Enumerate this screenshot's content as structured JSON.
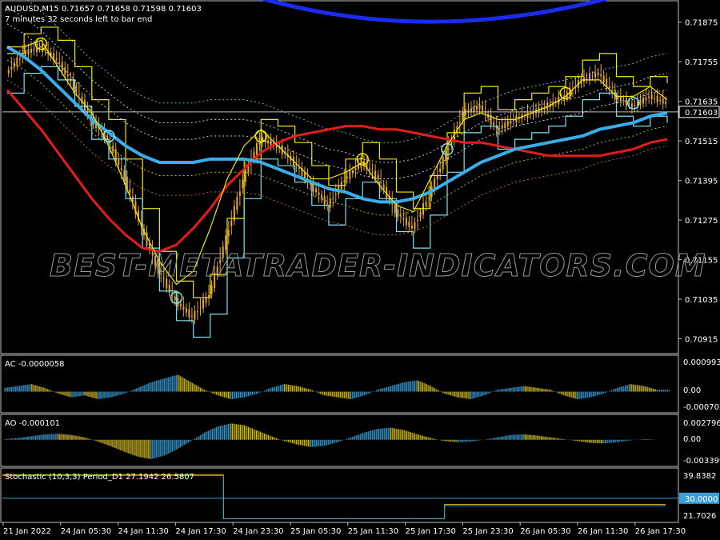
{
  "header": {
    "symbol_line": "AUDUSD,M15  0.71657 0.71658 0.71598 0.71603",
    "timer_line": "7 minutes 32 seconds left to bar end"
  },
  "watermark": "BEST-METATRADER-INDICATORS.COM",
  "colors": {
    "background": "#000000",
    "candle": "#e0a63a",
    "channel_yellow": "#f2e600",
    "channel_cyan": "#7fe0f0",
    "ma_blue_thick": "#3aaeea",
    "ma_red": "#e51c1c",
    "ma_navy": "#1a2cf0",
    "hist_yellow": "#d8c020",
    "hist_blue": "#3a9fd8",
    "stoch_main": "#d8c020",
    "stoch_signal": "#3a9fd8",
    "level_line": "#3a9fd8"
  },
  "chart_data": [
    {
      "type": "line",
      "panel": "price",
      "title": "AUDUSD,M15",
      "ohlc_last": {
        "open": 0.71657,
        "high": 0.71658,
        "low": 0.71598,
        "close": 0.71603
      },
      "current_price_label": "0.71603",
      "y_ticks": [
        "0.71875",
        "0.71755",
        "0.71635",
        "0.71515",
        "0.71395",
        "0.71275",
        "0.71155",
        "0.71035",
        "0.70915"
      ],
      "ylim": [
        0.70875,
        0.71935
      ],
      "x_ticks": [
        "21 Jan 2022",
        "24 Jan 05:30",
        "24 Jan 11:30",
        "24 Jan 17:30",
        "24 Jan 23:30",
        "25 Jan 05:30",
        "25 Jan 11:30",
        "25 Jan 17:30",
        "25 Jan 23:30",
        "26 Jan 05:30",
        "26 Jan 11:30",
        "26 Jan 17:30"
      ],
      "series": [
        {
          "values": [
            0.7172,
            0.7178,
            0.718,
            0.7176,
            0.7168,
            0.7158,
            0.7152,
            0.714,
            0.7125,
            0.7112,
            0.7103,
            0.7098,
            0.7105,
            0.7122,
            0.714,
            0.7152,
            0.715,
            0.7145,
            0.7138,
            0.7132,
            0.714,
            0.7145,
            0.714,
            0.713,
            0.7125,
            0.7135,
            0.7148,
            0.716,
            0.7162,
            0.7155,
            0.7158,
            0.716,
            0.7162,
            0.7165,
            0.717,
            0.7172,
            0.7165,
            0.7162,
            0.7165,
            0.7163
          ]
        },
        {
          "values": [
            0.718,
            0.718,
            0.7182,
            0.7174,
            0.7166,
            0.716,
            0.715,
            0.7138,
            0.7125,
            0.7115,
            0.7108,
            0.7112,
            0.7125,
            0.714,
            0.715,
            0.7155,
            0.715,
            0.7145,
            0.714,
            0.714,
            0.7142,
            0.7145,
            0.7138,
            0.7132,
            0.713,
            0.714,
            0.715,
            0.7158,
            0.716,
            0.7158,
            0.7158,
            0.716,
            0.7162,
            0.7165,
            0.717,
            0.717,
            0.7165,
            0.7165,
            0.7168,
            0.7164
          ]
        },
        {
          "values": [
            0.718,
            0.7177,
            0.7173,
            0.7168,
            0.7163,
            0.7158,
            0.7154,
            0.715,
            0.7147,
            0.7145,
            0.7145,
            0.7145,
            0.7146,
            0.7146,
            0.7146,
            0.7145,
            0.7143,
            0.7141,
            0.7139,
            0.7137,
            0.7136,
            0.7134,
            0.7133,
            0.7133,
            0.7134,
            0.7136,
            0.7139,
            0.7142,
            0.7145,
            0.7147,
            0.7149,
            0.715,
            0.7151,
            0.7152,
            0.7153,
            0.7155,
            0.7156,
            0.7157,
            0.7159,
            0.716
          ]
        },
        {
          "values": [
            0.7167,
            0.7161,
            0.7155,
            0.7148,
            0.7141,
            0.7134,
            0.7128,
            0.7123,
            0.7119,
            0.7118,
            0.712,
            0.7125,
            0.7131,
            0.7138,
            0.7143,
            0.7148,
            0.7151,
            0.7153,
            0.7154,
            0.7155,
            0.7156,
            0.7156,
            0.7155,
            0.7155,
            0.7154,
            0.7153,
            0.7152,
            0.7151,
            0.7151,
            0.715,
            0.7149,
            0.7148,
            0.7147,
            0.7147,
            0.7147,
            0.7147,
            0.7148,
            0.7149,
            0.7151,
            0.7152
          ]
        }
      ]
    },
    {
      "type": "bar",
      "panel": "AC",
      "title": "AC -0.0000058",
      "y_ticks": [
        "0.0009933",
        "0.00",
        "-0.0007027"
      ],
      "ylim": [
        -0.00095,
        0.00125
      ],
      "values": [
        0.0002,
        0.0003,
        0.0004,
        0.0002,
        -0.0001,
        -0.0003,
        -0.0002,
        -0.0004,
        -0.0003,
        -0.0001,
        0.0002,
        0.0005,
        0.0007,
        0.0009,
        0.0005,
        0.0001,
        -0.0002,
        -0.0004,
        -0.0003,
        -0.0001,
        0.0002,
        0.0004,
        0.0003,
        0.0001,
        -0.0002,
        -0.0003,
        -0.0004,
        -0.0002,
        0.0001,
        0.0003,
        0.0005,
        0.0006,
        0.0003,
        -0.0001,
        -0.0003,
        -0.0004,
        -0.0002,
        0.0001,
        0.0002,
        0.0003,
        0.0002,
        0.0001,
        -0.0002,
        -0.0004,
        -0.0003,
        -0.0001,
        0.0002,
        0.0004,
        0.0003,
        0.0001
      ]
    },
    {
      "type": "bar",
      "panel": "AO",
      "title": "AO -0.000101",
      "y_ticks": [
        "0.002796",
        "0.00",
        "-0.003399"
      ],
      "ylim": [
        -0.004,
        0.0034
      ],
      "values": [
        0.0001,
        0.0003,
        0.0006,
        0.0009,
        0.001,
        0.0008,
        0.0004,
        -0.0003,
        -0.0011,
        -0.002,
        -0.0028,
        -0.0032,
        -0.0026,
        -0.0015,
        -0.0002,
        0.0012,
        0.0022,
        0.0027,
        0.0024,
        0.0015,
        0.0006,
        -0.0002,
        -0.0008,
        -0.0012,
        -0.001,
        -0.0004,
        0.0004,
        0.0012,
        0.0018,
        0.002,
        0.0016,
        0.0009,
        0.0003,
        -0.0002,
        -0.0004,
        -0.0003,
        0.0,
        0.0004,
        0.0008,
        0.0009,
        0.0007,
        0.0004,
        0.0001,
        -0.0002,
        -0.0005,
        -0.0006,
        -0.0004,
        -0.0001,
        0.0001,
        0.0
      ]
    },
    {
      "type": "line",
      "panel": "Stochastic",
      "title": "Stochastic (10,3,3) Period_D1 27.1942 26.5807",
      "y_ticks": [
        "39.8382",
        "30.0000",
        "21.7026"
      ],
      "ylim": [
        19.5,
        42.5
      ],
      "level": 30.0,
      "series": [
        {
          "values": [
            40.5,
            40.5,
            40.5,
            40.5,
            40.5,
            40.5,
            40.5,
            40.5,
            40.5,
            40.5,
            40.5,
            40.5,
            40.5,
            20.8,
            20.8,
            20.8,
            20.8,
            20.8,
            20.8,
            20.8,
            20.8,
            20.8,
            20.8,
            20.8,
            20.8,
            20.8,
            27.2,
            27.2,
            27.2,
            27.2,
            27.2,
            27.2,
            27.2,
            27.2,
            27.2,
            27.2,
            27.2,
            27.2,
            27.2,
            27.2
          ]
        },
        {
          "values": [
            40.2,
            40.2,
            40.2,
            40.2,
            40.2,
            40.2,
            40.2,
            40.2,
            40.2,
            40.2,
            40.2,
            40.2,
            40.2,
            20.8,
            20.8,
            20.8,
            20.8,
            20.8,
            20.8,
            20.8,
            20.8,
            20.8,
            20.8,
            20.8,
            20.8,
            20.8,
            26.6,
            26.6,
            26.6,
            26.6,
            26.6,
            26.6,
            26.6,
            26.6,
            26.6,
            26.6,
            26.6,
            26.6,
            26.6,
            26.6
          ]
        }
      ]
    }
  ]
}
